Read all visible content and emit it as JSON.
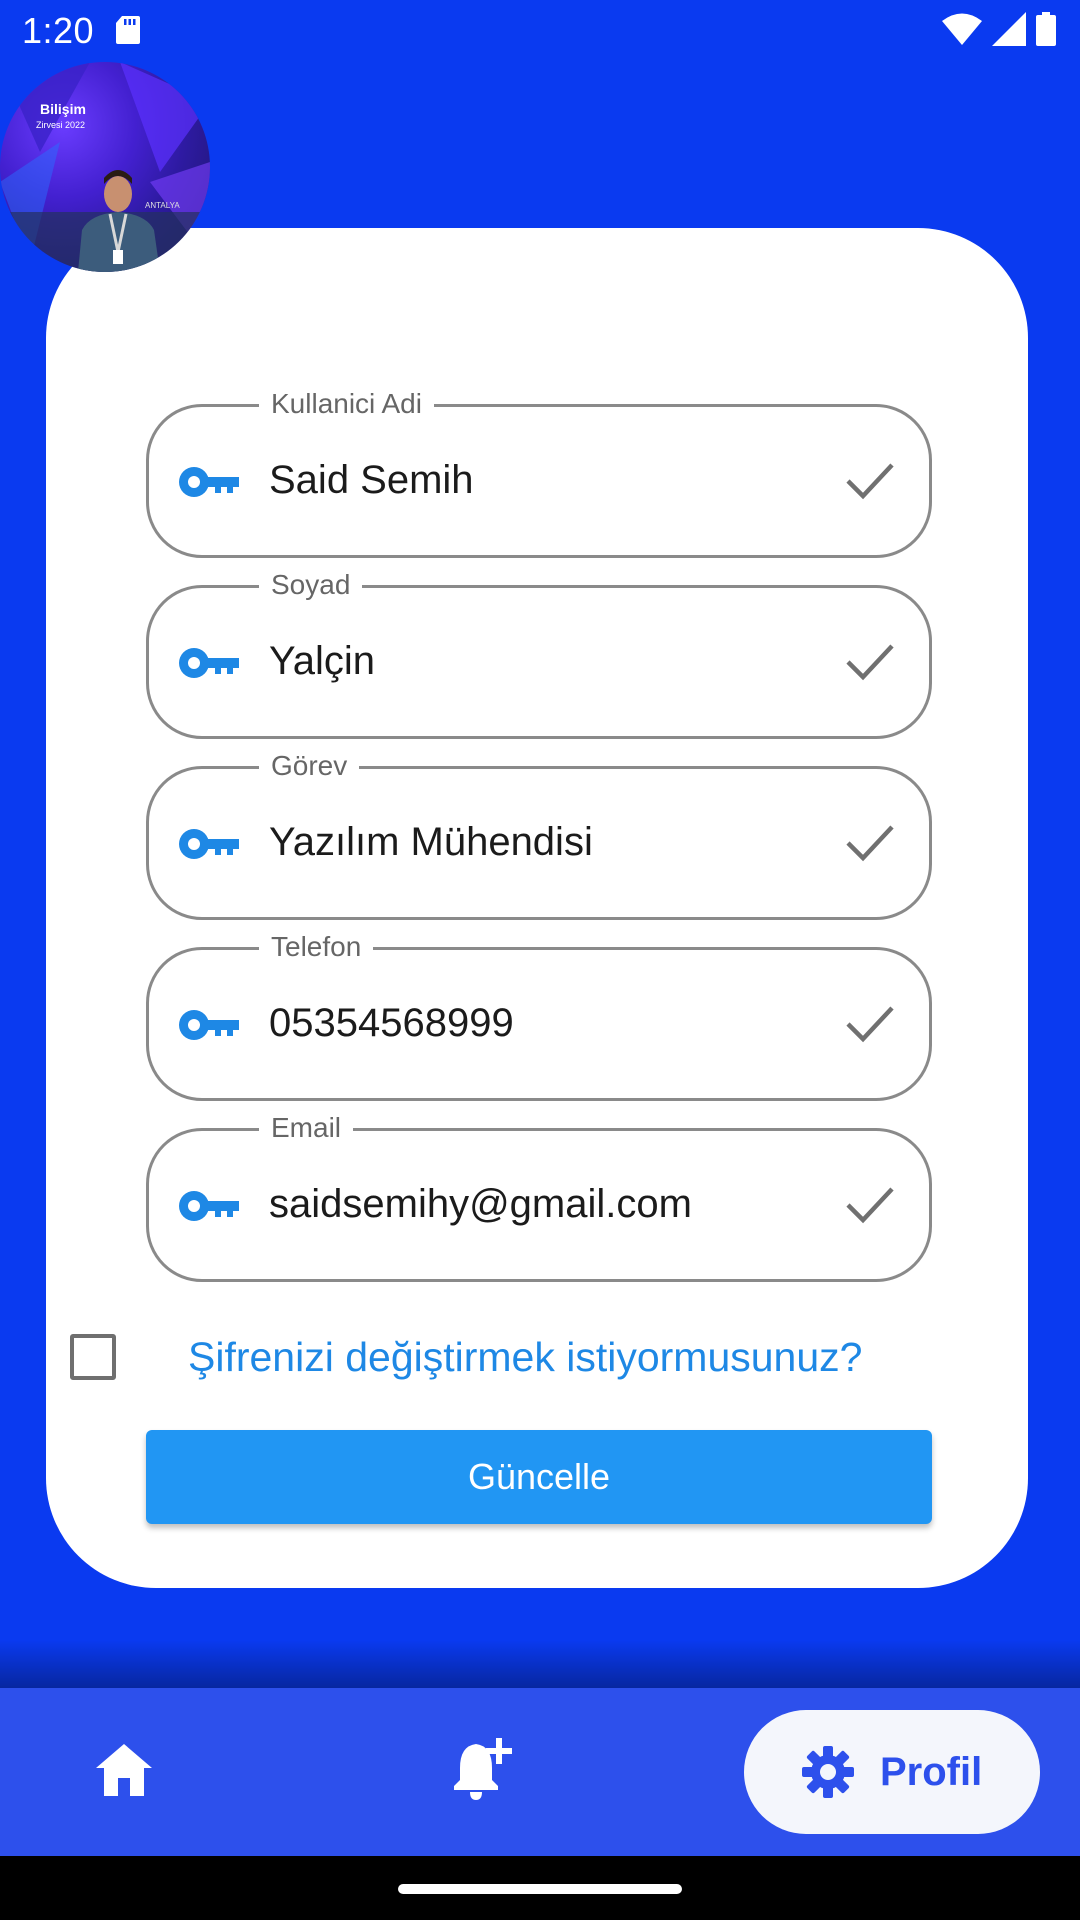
{
  "status_bar": {
    "time": "1:20"
  },
  "colors": {
    "background": "#0a3af0",
    "card": "#ffffff",
    "accent": "#2196f3",
    "link": "#1e88e5",
    "nav": "#2d50ec"
  },
  "form": {
    "fields": [
      {
        "label": "Kullanici Adi",
        "value": "Said Semih",
        "icon": "key-icon",
        "status_icon": "check-icon"
      },
      {
        "label": "Soyad",
        "value": "Yalçin",
        "icon": "key-icon",
        "status_icon": "check-icon"
      },
      {
        "label": "Görev",
        "value": "Yazılım Mühendisi",
        "icon": "key-icon",
        "status_icon": "check-icon"
      },
      {
        "label": "Telefon",
        "value": "05354568999",
        "icon": "key-icon",
        "status_icon": "check-icon"
      },
      {
        "label": "Email",
        "value": "saidsemihy@gmail.com",
        "icon": "key-icon",
        "status_icon": "check-icon"
      }
    ],
    "change_password_label": "Şifrenizi değiştirmek istiyormusunuz?",
    "change_password_checked": false,
    "update_button_label": "Güncelle"
  },
  "avatar": {
    "badge_line1": "Bilişim",
    "badge_line2": "Zirvesi 2022",
    "sign": "ANTALYA"
  },
  "bottom_nav": {
    "items": [
      {
        "icon": "home-icon",
        "label": ""
      },
      {
        "icon": "notification-add-icon",
        "label": ""
      },
      {
        "icon": "gear-icon",
        "label": "Profil",
        "selected": true
      }
    ]
  }
}
